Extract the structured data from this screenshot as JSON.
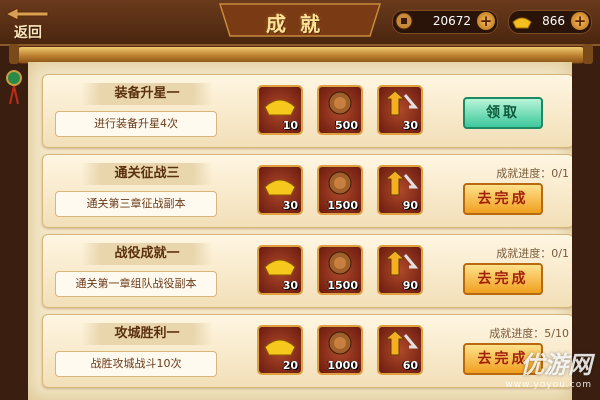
{
  "header": {
    "back_label": "返回",
    "title": "成就",
    "copper": "20672",
    "gold": "866"
  },
  "achievements": [
    {
      "name": "装备升星一",
      "desc": "进行装备升星4次",
      "progress": "",
      "action": "领取",
      "rewards": [
        "10",
        "500",
        "30"
      ]
    },
    {
      "name": "通关征战三",
      "desc": "通关第三章征战副本",
      "progress": "成就进度：0/1",
      "action": "去完成",
      "rewards": [
        "30",
        "1500",
        "90"
      ]
    },
    {
      "name": "战役成就一",
      "desc": "通关第一章组队战役副本",
      "progress": "成就进度：0/1",
      "action": "去完成",
      "rewards": [
        "30",
        "1500",
        "90"
      ]
    },
    {
      "name": "攻城胜利一",
      "desc": "战胜攻城战斗10次",
      "progress": "成就进度：5/10",
      "action": "去完成",
      "rewards": [
        "20",
        "1000",
        "60"
      ]
    }
  ],
  "icons": [
    "back-arrow-icon",
    "coin-icon",
    "gold-ingot-icon",
    "plus-icon",
    "gold-ingot-icon",
    "copper-coins-icon",
    "exp-icon"
  ],
  "colors": {
    "claim": "#3ec89c",
    "go": "#f0a020",
    "paper": "#f4e7c9"
  },
  "watermark": {
    "main": "优游网",
    "sub": "www.yoyou.com"
  }
}
